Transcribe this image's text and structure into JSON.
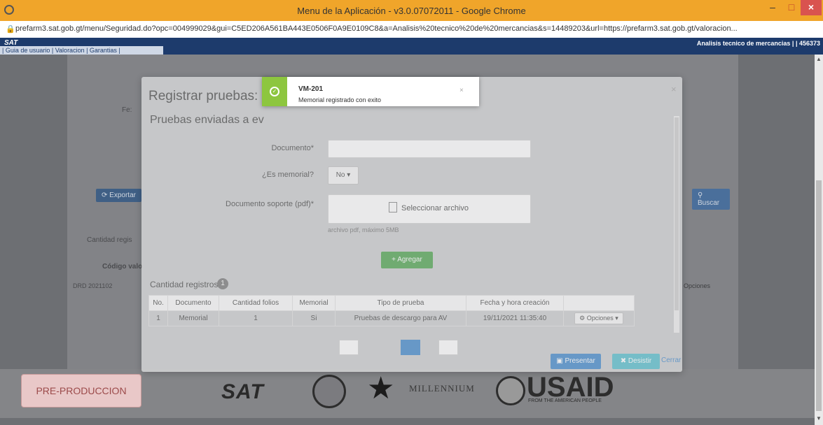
{
  "browser": {
    "title": "Menu de la Aplicación - v3.0.07072011 - Google Chrome",
    "url": "prefarm3.sat.gob.gt/menu/Seguridad.do?opc=004999029&gui=C5ED206A561BA443E0506F0A9E0109C8&a=Analisis%20tecnico%20de%20mercancias&s=14489203&url=https://prefarm3.sat.gob.gt/valoracion..."
  },
  "header": {
    "brand": "SAT",
    "right_text": "Analisis tecnico de mercancias | | 456373",
    "links": "| Guia de usuario | Valoracion | Garantias |"
  },
  "background": {
    "exportar": "Exportar",
    "buscar": "Buscar",
    "cantidad": "Cantidad regis",
    "codigo": "Código valo",
    "row1": "DRD 2021102",
    "opciones": "Opciones",
    "fe": "Fe:"
  },
  "modal": {
    "title": "Registrar pruebas: D",
    "subtitle": "Pruebas enviadas a ev",
    "documento_label": "Documento*",
    "es_memorial_label": "¿Es memorial?",
    "es_memorial_value": "No",
    "soporte_label": "Documento soporte (pdf)*",
    "seleccionar": "Seleccionar archivo",
    "help": "archivo pdf, máximo 5MB",
    "agregar": "Agregar",
    "cantidad_registros": "Cantidad registros",
    "count": "1",
    "table": {
      "headers": [
        "No.",
        "Documento",
        "Cantidad folios",
        "Memorial",
        "Tipo de prueba",
        "Fecha y hora creación",
        ""
      ],
      "rows": [
        [
          "1",
          "Memorial",
          "1",
          "Si",
          "Pruebas de descargo para AV",
          "19/11/2021 11:35:40",
          "Opciones"
        ]
      ]
    },
    "presentar": "Presentar",
    "desistir": "Desistir",
    "cerrar": "Cerrar"
  },
  "toast": {
    "title": "VM-201",
    "message": "Memorial registrado con exito",
    "close": "×"
  },
  "footer": {
    "preprod": "PRE-PRODUCCION",
    "sat_logo": "SAT",
    "millennium": "MILLENNIUM",
    "usaid": "USAID",
    "usaid_sub": "FROM THE AMERICAN PEOPLE"
  }
}
